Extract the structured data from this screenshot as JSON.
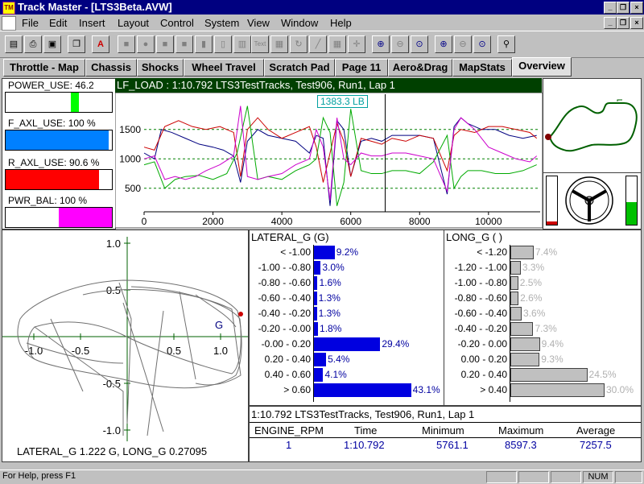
{
  "window": {
    "title": "Track Master - [LTS3Beta.AVW]",
    "app_icon": "TM"
  },
  "menu": [
    "File",
    "Edit",
    "Insert",
    "Layout",
    "Control",
    "System",
    "View",
    "Window",
    "Help"
  ],
  "toolbar_icons": [
    "new-icon",
    "print-icon",
    "save-icon",
    "copy-icon",
    "delete-icon",
    "box-icon",
    "circle-icon",
    "square-icon",
    "square-icon",
    "rect-icon",
    "bar-icon",
    "panel-icon",
    "text-icon",
    "table-icon",
    "rotate-icon",
    "line-icon",
    "grid-icon",
    "crosshair-icon",
    "zoom-in-icon",
    "zoom-out-icon",
    "zoom-fit-icon",
    "zoom-x-icon",
    "zoom-y-icon",
    "zoom-xy-icon",
    "find-icon"
  ],
  "tabs": [
    {
      "label": "Throttle - Map"
    },
    {
      "label": "Chassis"
    },
    {
      "label": "Shocks"
    },
    {
      "label": "Wheel Travel"
    },
    {
      "label": "Scratch Pad"
    },
    {
      "label": "Page 11"
    },
    {
      "label": "Aero&Drag"
    },
    {
      "label": "MapStats"
    },
    {
      "label": "Overview",
      "active": true
    }
  ],
  "gauges": [
    {
      "label": "POWER_USE: 46.2",
      "fill": 0.46,
      "color": "#00ff00",
      "mode": "marker"
    },
    {
      "label": "F_AXL_USE: 100 %",
      "fill": 1.0,
      "color": "#0080ff",
      "mode": "bar"
    },
    {
      "label": "R_AXL_USE: 90.6 %",
      "fill": 0.906,
      "color": "#ff0000",
      "mode": "bar"
    },
    {
      "label": "PWR_BAL: 100 %",
      "fill": 1.0,
      "color": "#ff00ff",
      "mode": "right-half"
    }
  ],
  "main_chart": {
    "header": "LF_LOAD : 1:10.792 LTS3TestTracks, Test906, Run1, Lap 1",
    "tooltip": "1383.3 LB",
    "chart_data": {
      "type": "line",
      "xlim": [
        0,
        11500
      ],
      "ylim": [
        100,
        2100
      ],
      "x_ticks": [
        0,
        2000,
        4000,
        6000,
        8000,
        10000
      ],
      "y_ticks": [
        500,
        1000,
        1500
      ],
      "grid": "dashed-horizontal",
      "cursor_x": 7000,
      "series": [
        {
          "color": "#000080",
          "x": [
            0,
            300,
            500,
            800,
            1200,
            1600,
            2000,
            2300,
            2600,
            2800,
            3000,
            3300,
            3600,
            4000,
            4400,
            4800,
            5000,
            5200,
            5400,
            5600,
            5800,
            6000,
            6300,
            6600,
            6900,
            7200,
            7600,
            8000,
            8400,
            8800,
            9000,
            9200,
            9400,
            9800,
            10200,
            10600,
            11000,
            11400
          ],
          "y": [
            1100,
            1000,
            1500,
            1450,
            1350,
            1250,
            1200,
            1150,
            1050,
            600,
            1300,
            1500,
            1400,
            1350,
            1300,
            1100,
            1400,
            1350,
            200,
            1650,
            1500,
            700,
            1300,
            1350,
            1300,
            1400,
            1400,
            1400,
            1350,
            400,
            1550,
            1700,
            1600,
            1500,
            1500,
            1400,
            1350,
            1400
          ]
        },
        {
          "color": "#cc0000",
          "x": [
            0,
            300,
            600,
            1000,
            1400,
            1800,
            2200,
            2600,
            2800,
            3000,
            3300,
            3600,
            4000,
            4400,
            4800,
            5000,
            5200,
            5400,
            5600,
            5800,
            6000,
            6300,
            6600,
            6900,
            7200,
            7600,
            8000,
            8400,
            8800,
            9000,
            9200,
            9600,
            10000,
            10400,
            10800,
            11200,
            11400
          ],
          "y": [
            1200,
            1150,
            1550,
            1650,
            1550,
            1500,
            1550,
            1450,
            700,
            1500,
            1700,
            1500,
            1350,
            1450,
            1550,
            1200,
            600,
            1100,
            1600,
            1300,
            700,
            1350,
            1300,
            1250,
            1350,
            1300,
            1400,
            1350,
            800,
            1400,
            1500,
            1450,
            1550,
            1550,
            1500,
            1450,
            1350
          ]
        },
        {
          "color": "#00aa00",
          "x": [
            0,
            300,
            600,
            900,
            1200,
            1600,
            2000,
            2400,
            2700,
            3000,
            3300,
            3600,
            4000,
            4400,
            4800,
            5000,
            5200,
            5400,
            5600,
            5800,
            6000,
            6300,
            6600,
            6900,
            7200,
            7600,
            8000,
            8400,
            8800,
            9000,
            9200,
            9400,
            9800,
            10200,
            10600,
            11000,
            11400
          ],
          "y": [
            900,
            950,
            500,
            650,
            700,
            720,
            650,
            750,
            1100,
            1900,
            650,
            700,
            650,
            800,
            900,
            1000,
            1700,
            1450,
            200,
            600,
            1850,
            800,
            750,
            750,
            800,
            800,
            750,
            950,
            1400,
            500,
            700,
            800,
            800,
            750,
            750,
            800,
            900
          ]
        },
        {
          "color": "#cc00cc",
          "x": [
            0,
            300,
            600,
            900,
            1200,
            1500,
            1800,
            2200,
            2600,
            2800,
            3000,
            3300,
            3600,
            4000,
            4400,
            4800,
            5000,
            5200,
            5400,
            5600,
            5800,
            6000,
            6300,
            6600,
            6900,
            7200,
            7600,
            8000,
            8400,
            8800,
            9000,
            9200,
            9600,
            10000,
            10400,
            10800,
            11200,
            11400
          ],
          "y": [
            1000,
            1050,
            650,
            700,
            650,
            700,
            800,
            900,
            1050,
            1900,
            700,
            650,
            700,
            750,
            900,
            1000,
            1500,
            1200,
            300,
            1700,
            1000,
            900,
            1100,
            1050,
            1050,
            1100,
            1100,
            1050,
            1000,
            450,
            1500,
            1700,
            1500,
            1200,
            1100,
            1000,
            950,
            1050
          ]
        }
      ]
    }
  },
  "lateral_hist": {
    "title": "LATERAL_G (G)",
    "rows": [
      {
        "range": "< -1.00",
        "pct": 9.2,
        "label": "9.2%"
      },
      {
        "range": "-1.00 - -0.80",
        "pct": 3.0,
        "label": "3.0%"
      },
      {
        "range": "-0.80 - -0.60",
        "pct": 1.6,
        "label": "1.6%"
      },
      {
        "range": "-0.60 - -0.40",
        "pct": 1.3,
        "label": "1.3%"
      },
      {
        "range": "-0.40 - -0.20",
        "pct": 1.3,
        "label": "1.3%"
      },
      {
        "range": "-0.20 - -0.00",
        "pct": 1.8,
        "label": "1.8%"
      },
      {
        "range": "-0.00 - 0.20",
        "pct": 29.4,
        "label": "29.4%"
      },
      {
        "range": "0.20 - 0.40",
        "pct": 5.4,
        "label": "5.4%"
      },
      {
        "range": "0.40 - 0.60",
        "pct": 4.1,
        "label": "4.1%"
      },
      {
        "range": "> 0.60",
        "pct": 43.1,
        "label": "43.1%"
      }
    ]
  },
  "long_hist": {
    "title": "LONG_G (  )",
    "rows": [
      {
        "range": "< -1.20",
        "pct": 7.4,
        "label": "7.4%"
      },
      {
        "range": "-1.20 - -1.00",
        "pct": 3.3,
        "label": "3.3%"
      },
      {
        "range": "-1.00 - -0.80",
        "pct": 2.5,
        "label": "2.5%"
      },
      {
        "range": "-0.80 - -0.60",
        "pct": 2.6,
        "label": "2.6%"
      },
      {
        "range": "-0.60 - -0.40",
        "pct": 3.6,
        "label": "3.6%"
      },
      {
        "range": "-0.40 - -0.20",
        "pct": 7.3,
        "label": "7.3%"
      },
      {
        "range": "-0.20 - 0.00",
        "pct": 9.4,
        "label": "9.4%"
      },
      {
        "range": "0.00 - 0.20",
        "pct": 9.3,
        "label": "9.3%"
      },
      {
        "range": "0.20 - 0.40",
        "pct": 24.5,
        "label": "24.5%"
      },
      {
        "range": "> 0.40",
        "pct": 30.0,
        "label": "30.0%"
      }
    ]
  },
  "gg_plot": {
    "caption": "LATERAL_G 1.222 G, LONG_G 0.27095",
    "marker": "G",
    "x_ticks": [
      "-1.0",
      "-0.5",
      "0.5",
      "1.0"
    ],
    "y_ticks": [
      "1.0",
      "0.5",
      "-0.5",
      "-1.0"
    ]
  },
  "stats": {
    "header": "1:10.792 LTS3TestTracks, Test906, Run1, Lap 1",
    "columns": [
      "ENGINE_RPM",
      "Time",
      "Minimum",
      "Maximum",
      "Average"
    ],
    "row": [
      "1",
      "1:10.792",
      "5761.1",
      "8597.3",
      "7257.5"
    ]
  },
  "status": {
    "help": "For Help, press F1",
    "num": "NUM"
  }
}
